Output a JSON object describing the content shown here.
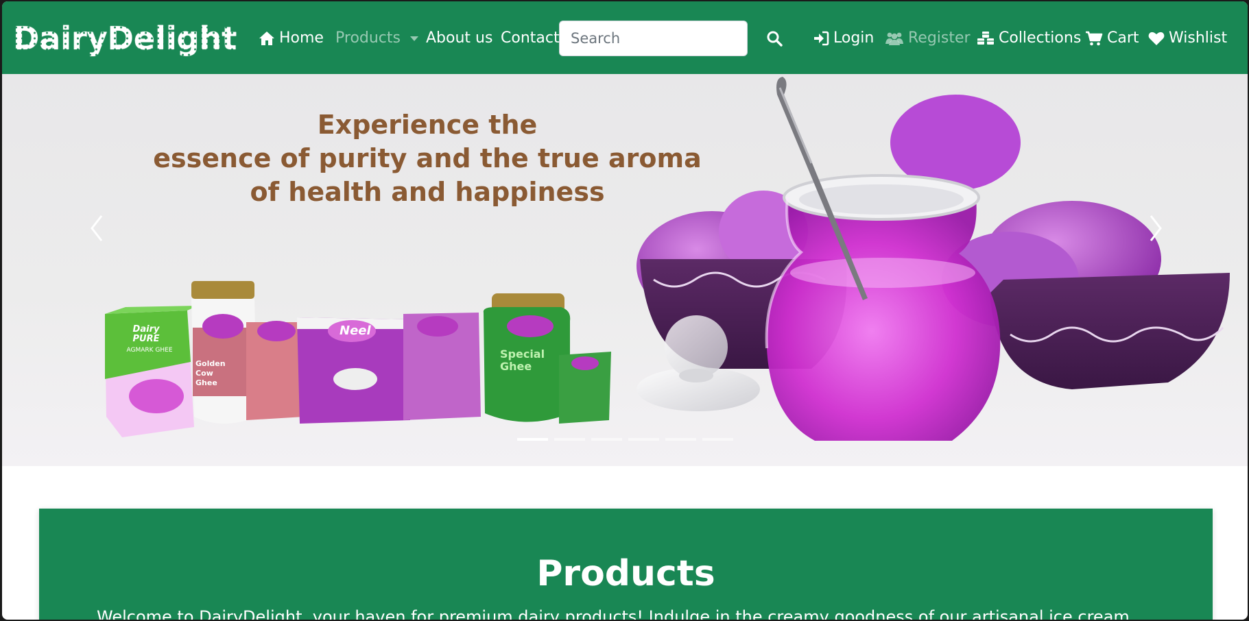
{
  "brand": {
    "name": "DairyDelight"
  },
  "nav": {
    "home": "Home",
    "products": "Products",
    "about": "About us",
    "contact": "Contact",
    "login": "Login",
    "register": "Register",
    "collections": "Collections",
    "cart": "Cart",
    "wishlist": "Wishlist"
  },
  "search": {
    "placeholder": "Search",
    "value": ""
  },
  "hero": {
    "line1": "Experience the",
    "line2": "essence of purity and the true aroma",
    "line3": "of health and happiness",
    "product_labels": {
      "dairy_pure": "Dairy PURE",
      "agmark": "AGMARK GHEE",
      "brand_mark": "Neel",
      "golden": "Golden Cow Ghee",
      "special": "Special Ghee"
    },
    "slide_count": 6,
    "active_slide": 1
  },
  "products": {
    "title": "Products",
    "intro": "Welcome to DairyDelight, your haven for premium dairy products! Indulge in the creamy goodness of our artisanal ice cream"
  },
  "colors": {
    "primary": "#198754",
    "hero_text": "#8a5a33",
    "purple": "#c23fd6"
  },
  "icons": {
    "home": "home-icon",
    "search": "search-icon",
    "login": "login-icon",
    "register": "users-icon",
    "collections": "cubes-icon",
    "cart": "cart-icon",
    "wishlist": "heart-icon"
  }
}
